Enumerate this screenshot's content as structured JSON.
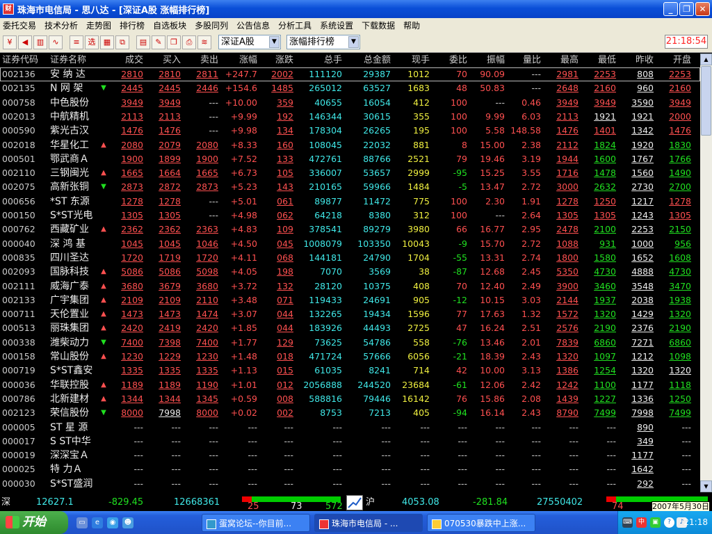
{
  "window": {
    "title": "珠海市电信局 - 思八达 - [深证A股 涨幅排行榜]",
    "app_icon": "财"
  },
  "menu": [
    "委托交易",
    "技术分析",
    "走势图",
    "排行榜",
    "自选板块",
    "多股同列",
    "公告信息",
    "分析工具",
    "系统设置",
    "下载数据",
    "帮助"
  ],
  "toolbar": {
    "buttons": [
      {
        "name": "trade-button",
        "glyph": "¥"
      },
      {
        "name": "alert-button",
        "glyph": "◀"
      },
      {
        "name": "kline-button",
        "glyph": "▥"
      },
      {
        "name": "trend-button",
        "glyph": "∿"
      },
      {
        "name": "list-button",
        "glyph": "≡"
      },
      {
        "name": "select-button",
        "glyph": "选"
      },
      {
        "name": "grid-button",
        "glyph": "▦"
      },
      {
        "name": "window-button",
        "glyph": "⧉"
      },
      {
        "name": "report-button",
        "glyph": "▤"
      },
      {
        "name": "edit-button",
        "glyph": "✎"
      },
      {
        "name": "copy-button",
        "glyph": "❐"
      },
      {
        "name": "print-button",
        "glyph": "⎙"
      },
      {
        "name": "wave-button",
        "glyph": "≋"
      }
    ],
    "market_select": "深证A股",
    "rank_select": "涨幅排行榜",
    "clock": "21:18:54"
  },
  "columns": [
    "证券代码",
    "证券名称",
    "成交",
    "买入",
    "卖出",
    "涨幅",
    "涨跌",
    "总手",
    "总金额",
    "现手",
    "委比",
    "振幅",
    "量比",
    "最高",
    "最低",
    "昨收",
    "开盘"
  ],
  "rows": [
    {
      "code": "002136",
      "name": "安 纳 达",
      "arrow": "",
      "v": [
        "2810",
        "2810",
        "2811",
        "+247.7",
        "2002",
        "111120",
        "29387",
        "1012",
        "70",
        "90.09",
        "---",
        "2981",
        "2253",
        "808",
        "2253"
      ]
    },
    {
      "code": "002135",
      "name": "N 网  架",
      "arrow": "down",
      "v": [
        "2445",
        "2445",
        "2446",
        "+154.6",
        "1485",
        "265012",
        "63527",
        "1683",
        "48",
        "50.83",
        "---",
        "2648",
        "2160",
        "960",
        "2160"
      ]
    },
    {
      "code": "000758",
      "name": "中色股份",
      "arrow": "",
      "v": [
        "3949",
        "3949",
        "---",
        "+10.00",
        "359",
        "40655",
        "16054",
        "412",
        "100",
        "---",
        "0.46",
        "3949",
        "3949",
        "3590",
        "3949"
      ]
    },
    {
      "code": "002013",
      "name": "中航精机",
      "arrow": "",
      "v": [
        "2113",
        "2113",
        "---",
        "+9.99",
        "192",
        "146344",
        "30615",
        "355",
        "100",
        "9.99",
        "6.03",
        "2113",
        "1921",
        "1921",
        "2000"
      ]
    },
    {
      "code": "000590",
      "name": "紫光古汉",
      "arrow": "",
      "v": [
        "1476",
        "1476",
        "---",
        "+9.98",
        "134",
        "178304",
        "26265",
        "195",
        "100",
        "5.58",
        "148.58",
        "1476",
        "1401",
        "1342",
        "1476"
      ]
    },
    {
      "code": "002018",
      "name": "华星化工",
      "arrow": "up",
      "v": [
        "2080",
        "2079",
        "2080",
        "+8.33",
        "160",
        "108045",
        "22032",
        "881",
        "8",
        "15.00",
        "2.38",
        "2112",
        "1824",
        "1920",
        "1830"
      ]
    },
    {
      "code": "000501",
      "name": "鄂武商Ａ",
      "arrow": "",
      "v": [
        "1900",
        "1899",
        "1900",
        "+7.52",
        "133",
        "472761",
        "88766",
        "2521",
        "79",
        "19.46",
        "3.19",
        "1944",
        "1600",
        "1767",
        "1766"
      ]
    },
    {
      "code": "002110",
      "name": "三钢闽光",
      "arrow": "up",
      "v": [
        "1665",
        "1664",
        "1665",
        "+6.73",
        "105",
        "336007",
        "53657",
        "2999",
        "-95",
        "15.25",
        "3.55",
        "1716",
        "1478",
        "1560",
        "1490"
      ]
    },
    {
      "code": "002075",
      "name": "高新张铜",
      "arrow": "down",
      "v": [
        "2873",
        "2872",
        "2873",
        "+5.23",
        "143",
        "210165",
        "59966",
        "1484",
        "-5",
        "13.47",
        "2.72",
        "3000",
        "2632",
        "2730",
        "2700"
      ]
    },
    {
      "code": "000656",
      "name": "*ST 东源",
      "arrow": "",
      "v": [
        "1278",
        "1278",
        "---",
        "+5.01",
        "061",
        "89877",
        "11472",
        "775",
        "100",
        "2.30",
        "1.91",
        "1278",
        "1250",
        "1217",
        "1278"
      ]
    },
    {
      "code": "000150",
      "name": "S*ST光电",
      "arrow": "",
      "v": [
        "1305",
        "1305",
        "---",
        "+4.98",
        "062",
        "64218",
        "8380",
        "312",
        "100",
        "---",
        "2.64",
        "1305",
        "1305",
        "1243",
        "1305"
      ]
    },
    {
      "code": "000762",
      "name": "西藏矿业",
      "arrow": "up",
      "v": [
        "2362",
        "2362",
        "2363",
        "+4.83",
        "109",
        "378541",
        "89279",
        "3980",
        "66",
        "16.77",
        "2.95",
        "2478",
        "2100",
        "2253",
        "2150"
      ]
    },
    {
      "code": "000040",
      "name": "深 鸿 基",
      "arrow": "",
      "v": [
        "1045",
        "1045",
        "1046",
        "+4.50",
        "045",
        "1008079",
        "103350",
        "10043",
        "-9",
        "15.70",
        "2.72",
        "1088",
        "931",
        "1000",
        "956"
      ]
    },
    {
      "code": "000835",
      "name": "四川圣达",
      "arrow": "",
      "v": [
        "1720",
        "1719",
        "1720",
        "+4.11",
        "068",
        "144181",
        "24790",
        "1704",
        "-55",
        "13.31",
        "2.74",
        "1800",
        "1580",
        "1652",
        "1608"
      ]
    },
    {
      "code": "002093",
      "name": "国脉科技",
      "arrow": "up",
      "v": [
        "5086",
        "5086",
        "5098",
        "+4.05",
        "198",
        "7070",
        "3569",
        "38",
        "-87",
        "12.68",
        "2.45",
        "5350",
        "4730",
        "4888",
        "4730"
      ]
    },
    {
      "code": "002111",
      "name": "威海广泰",
      "arrow": "up",
      "v": [
        "3680",
        "3679",
        "3680",
        "+3.72",
        "132",
        "28120",
        "10375",
        "408",
        "70",
        "12.40",
        "2.49",
        "3900",
        "3460",
        "3548",
        "3470"
      ]
    },
    {
      "code": "002133",
      "name": "广宇集团",
      "arrow": "up",
      "v": [
        "2109",
        "2109",
        "2110",
        "+3.48",
        "071",
        "119433",
        "24691",
        "905",
        "-12",
        "10.15",
        "3.03",
        "2144",
        "1937",
        "2038",
        "1938"
      ]
    },
    {
      "code": "000711",
      "name": "天伦置业",
      "arrow": "up",
      "v": [
        "1473",
        "1473",
        "1474",
        "+3.07",
        "044",
        "132265",
        "19434",
        "1596",
        "77",
        "17.63",
        "1.32",
        "1572",
        "1320",
        "1429",
        "1320"
      ]
    },
    {
      "code": "000513",
      "name": "丽珠集团",
      "arrow": "up",
      "v": [
        "2420",
        "2419",
        "2420",
        "+1.85",
        "044",
        "183926",
        "44493",
        "2725",
        "47",
        "16.24",
        "2.51",
        "2576",
        "2190",
        "2376",
        "2190"
      ]
    },
    {
      "code": "000338",
      "name": "潍柴动力",
      "arrow": "down",
      "v": [
        "7400",
        "7398",
        "7400",
        "+1.77",
        "129",
        "73625",
        "54786",
        "558",
        "-76",
        "13.46",
        "2.01",
        "7839",
        "6860",
        "7271",
        "6860"
      ]
    },
    {
      "code": "000158",
      "name": "常山股份",
      "arrow": "up",
      "v": [
        "1230",
        "1229",
        "1230",
        "+1.48",
        "018",
        "471724",
        "57666",
        "6056",
        "-21",
        "18.39",
        "2.43",
        "1320",
        "1097",
        "1212",
        "1098"
      ]
    },
    {
      "code": "000719",
      "name": "S*ST鑫安",
      "arrow": "",
      "v": [
        "1335",
        "1335",
        "1335",
        "+1.13",
        "015",
        "61035",
        "8241",
        "714",
        "42",
        "10.00",
        "3.13",
        "1386",
        "1254",
        "1320",
        "1320"
      ]
    },
    {
      "code": "000036",
      "name": "华联控股",
      "arrow": "up",
      "v": [
        "1189",
        "1189",
        "1190",
        "+1.01",
        "012",
        "2056888",
        "244520",
        "23684",
        "-61",
        "12.06",
        "2.42",
        "1242",
        "1100",
        "1177",
        "1118"
      ]
    },
    {
      "code": "000786",
      "name": "北新建材",
      "arrow": "up",
      "v": [
        "1344",
        "1344",
        "1345",
        "+0.59",
        "008",
        "588816",
        "79446",
        "16142",
        "76",
        "15.86",
        "2.08",
        "1439",
        "1227",
        "1336",
        "1250"
      ]
    },
    {
      "code": "002123",
      "name": "荣信股份",
      "arrow": "down",
      "v": [
        "8000",
        "7998",
        "8000",
        "+0.02",
        "002",
        "8753",
        "7213",
        "405",
        "-94",
        "16.14",
        "2.43",
        "8790",
        "7499",
        "7998",
        "7499"
      ]
    },
    {
      "code": "000005",
      "name": "ST 星 源",
      "arrow": "",
      "v": [
        "---",
        "---",
        "---",
        "---",
        "---",
        "---",
        "---",
        "---",
        "---",
        "---",
        "---",
        "---",
        "---",
        "890",
        "---"
      ]
    },
    {
      "code": "000017",
      "name": "S ST中华",
      "arrow": "",
      "v": [
        "---",
        "---",
        "---",
        "---",
        "---",
        "---",
        "---",
        "---",
        "---",
        "---",
        "---",
        "---",
        "---",
        "349",
        "---"
      ]
    },
    {
      "code": "000019",
      "name": "深深宝Ａ",
      "arrow": "",
      "v": [
        "---",
        "---",
        "---",
        "---",
        "---",
        "---",
        "---",
        "---",
        "---",
        "---",
        "---",
        "---",
        "---",
        "1177",
        "---"
      ]
    },
    {
      "code": "000025",
      "name": "特  力Ａ",
      "arrow": "",
      "v": [
        "---",
        "---",
        "---",
        "---",
        "---",
        "---",
        "---",
        "---",
        "---",
        "---",
        "---",
        "---",
        "---",
        "1642",
        "---"
      ]
    },
    {
      "code": "000030",
      "name": "S*ST盛润",
      "arrow": "",
      "v": [
        "---",
        "---",
        "---",
        "---",
        "---",
        "---",
        "---",
        "---",
        "---",
        "---",
        "---",
        "---",
        "---",
        "292",
        "---"
      ]
    }
  ],
  "status": {
    "sz_label": "深",
    "sz_index": "12627.1",
    "sz_change": "-829.45",
    "sz_volume": "12668361",
    "sz_up": "25",
    "sz_flat": "73",
    "sz_down": "572",
    "sh_label": "沪",
    "sh_index": "4053.08",
    "sh_change": "-281.84",
    "sh_volume": "27550402",
    "sh_up": "74",
    "date": "2007年5月30日"
  },
  "taskbar": {
    "start": "开始",
    "tasks": [
      "蛋窝论坛--你目前...",
      "珠海市电信局 - ...",
      "070530暴跌中上涨..."
    ],
    "time": "21:18"
  },
  "colors": {
    "up": "#ff5050",
    "down": "#20e020",
    "neutral": "#eeeeee",
    "cyan": "#40e8e8",
    "yellow": "#f0f040"
  }
}
